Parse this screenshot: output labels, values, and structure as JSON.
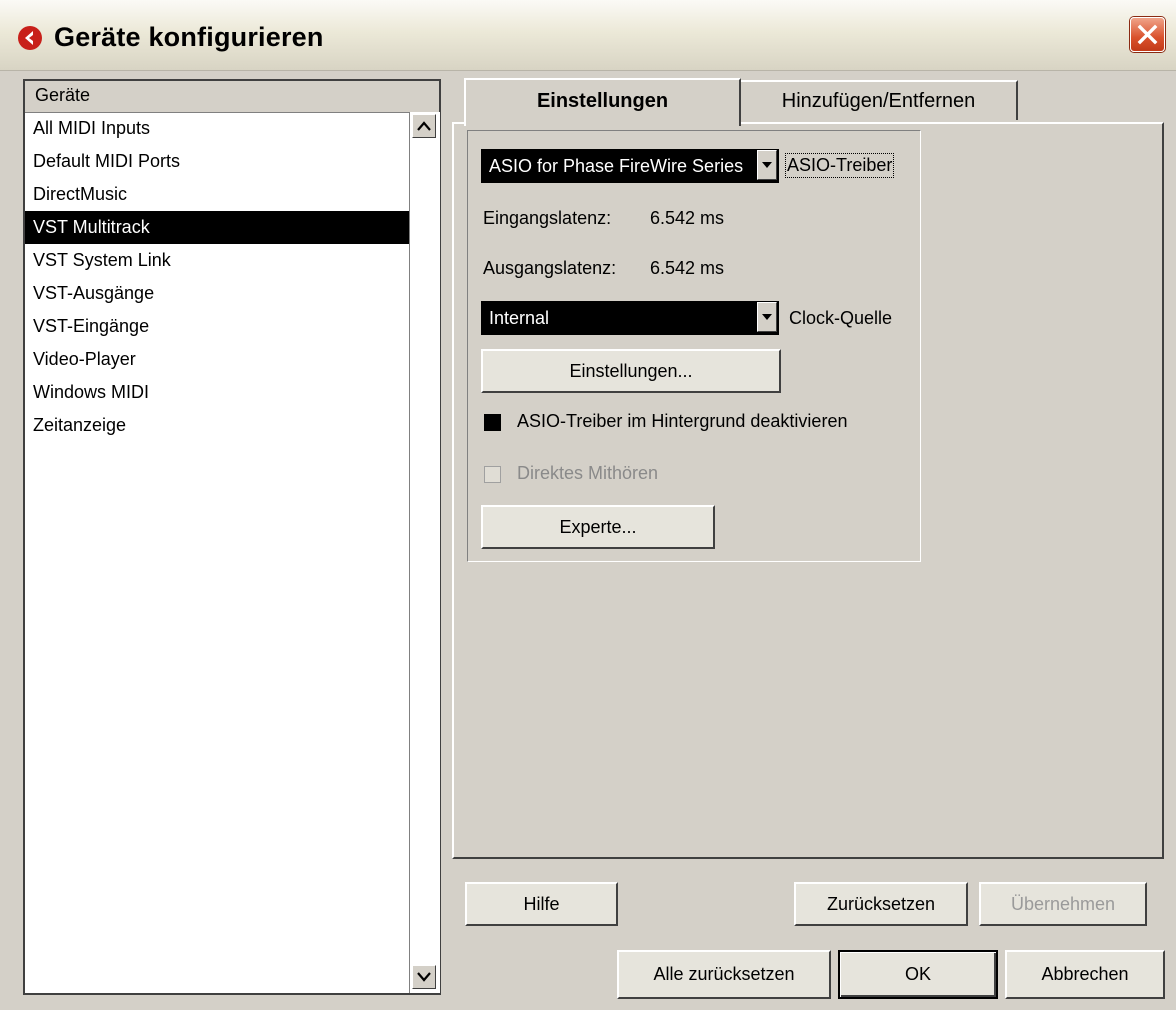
{
  "window": {
    "title": "Geräte konfigurieren"
  },
  "device_list": {
    "header": "Geräte",
    "items": [
      {
        "label": "All MIDI Inputs",
        "selected": false
      },
      {
        "label": "Default MIDI Ports",
        "selected": false
      },
      {
        "label": "DirectMusic",
        "selected": false
      },
      {
        "label": "VST Multitrack",
        "selected": true
      },
      {
        "label": "VST System Link",
        "selected": false
      },
      {
        "label": "VST-Ausgänge",
        "selected": false
      },
      {
        "label": "VST-Eingänge",
        "selected": false
      },
      {
        "label": "Video-Player",
        "selected": false
      },
      {
        "label": "Windows MIDI",
        "selected": false
      },
      {
        "label": "Zeitanzeige",
        "selected": false
      }
    ]
  },
  "tabs": [
    {
      "label": "Einstellungen",
      "active": true
    },
    {
      "label": "Hinzufügen/Entfernen",
      "active": false
    }
  ],
  "settings": {
    "asio_driver_value": "ASIO for Phase FireWire Series",
    "asio_driver_label": "ASIO-Treiber",
    "input_latency_label": "Eingangslatenz:",
    "input_latency_value": "6.542 ms",
    "output_latency_label": "Ausgangslatenz:",
    "output_latency_value": "6.542 ms",
    "clock_source_value": "Internal",
    "clock_source_label": "Clock-Quelle",
    "settings_button": "Einstellungen...",
    "deactivate_checkbox_label": "ASIO-Treiber im Hintergrund deaktivieren",
    "deactivate_checked": true,
    "direct_monitoring_label": "Direktes Mithören",
    "direct_monitoring_enabled": false,
    "expert_button": "Experte..."
  },
  "panel_buttons": {
    "help": "Hilfe",
    "reset": "Zurücksetzen",
    "apply": "Übernehmen"
  },
  "dialog_buttons": {
    "reset_all": "Alle zurücksetzen",
    "ok": "OK",
    "cancel": "Abbrechen"
  },
  "colors": {
    "selection": "#000000",
    "close_button": "#d9512c",
    "app_icon": "#c8201a"
  },
  "icons": {
    "app": "cubase-logo-icon",
    "close": "close-icon",
    "scroll_up": "chevron-up-icon",
    "scroll_down": "chevron-down-icon",
    "dropdown": "triangle-down-icon"
  }
}
